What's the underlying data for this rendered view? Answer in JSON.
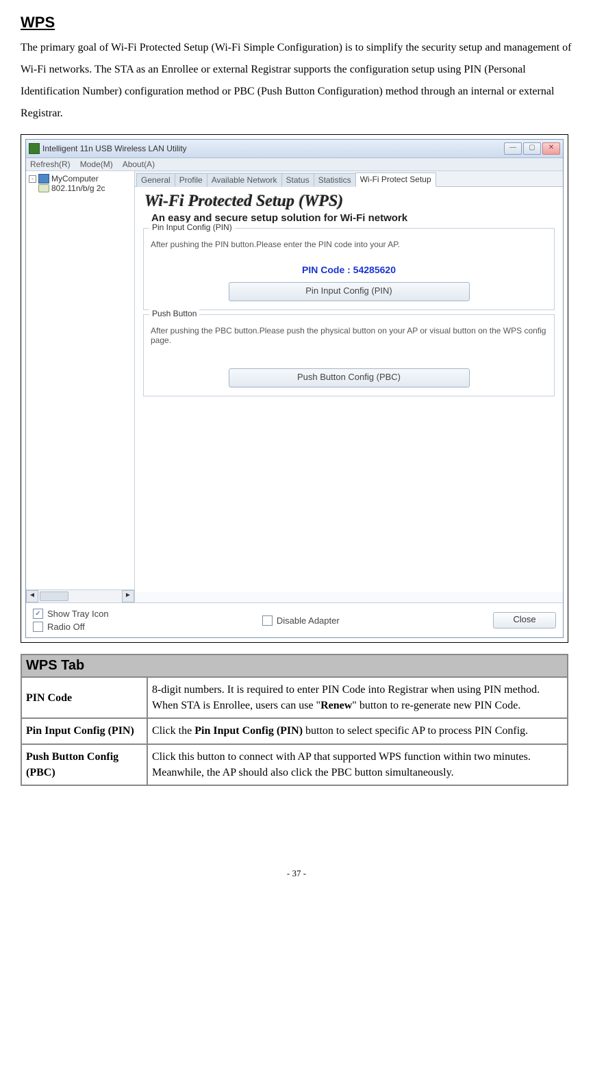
{
  "doc": {
    "heading": "WPS",
    "intro": "The primary goal of Wi-Fi Protected Setup (Wi-Fi Simple Configuration) is to simplify the security setup and management of Wi-Fi networks. The STA as an Enrollee or external Registrar supports the configuration setup using PIN (Personal Identification Number) configuration method or PBC (Push Button Configuration) method through an internal or external Registrar.",
    "page_footer": "- 37 -"
  },
  "window": {
    "title": "Intelligent 11n USB Wireless LAN Utility",
    "menus": {
      "refresh": "Refresh(R)",
      "mode": "Mode(M)",
      "about": "About(A)"
    },
    "tree": {
      "root": "MyComputer",
      "child": "802.11n/b/g 2c"
    },
    "tabs": {
      "general": "General",
      "profile": "Profile",
      "available": "Available Network",
      "status": "Status",
      "statistics": "Statistics",
      "wps": "Wi-Fi Protect Setup"
    },
    "wps": {
      "title": "Wi-Fi Protected Setup (WPS)",
      "subtitle": "An easy and secure setup solution for Wi-Fi network",
      "pin": {
        "legend": "Pin Input Config (PIN)",
        "desc": "After pushing the PIN button.Please enter the PIN code into your AP.",
        "pin_label": "PIN Code :  54285620",
        "button": "Pin Input Config (PIN)"
      },
      "pbc": {
        "legend": "Push Button",
        "desc": "After pushing the PBC button.Please push the physical button on your AP or visual button on the WPS config page.",
        "button": "Push Button Config (PBC)"
      }
    },
    "bottom": {
      "show_tray": "Show Tray Icon",
      "radio_off": "Radio Off",
      "disable_adapter": "Disable Adapter",
      "close": "Close"
    }
  },
  "table": {
    "header": "WPS Tab",
    "rows": {
      "pin_code": {
        "k": "PIN Code",
        "v_pre": "8-digit numbers. It is required to enter PIN Code into Registrar when using PIN method. When STA is Enrollee, users can use \"",
        "v_bold": "Renew",
        "v_post": "\" button to re-generate new PIN Code."
      },
      "pin_cfg": {
        "k": "Pin Input Config (PIN)",
        "v_pre": "Click the ",
        "v_bold": "Pin Input Config (PIN)",
        "v_post": " button to select specific AP to process PIN Config."
      },
      "pbc": {
        "k": "Push Button Config (PBC)",
        "v": "Click this button to connect with AP that supported WPS function within two minutes. Meanwhile, the AP should also click the PBC button simultaneously."
      }
    }
  }
}
